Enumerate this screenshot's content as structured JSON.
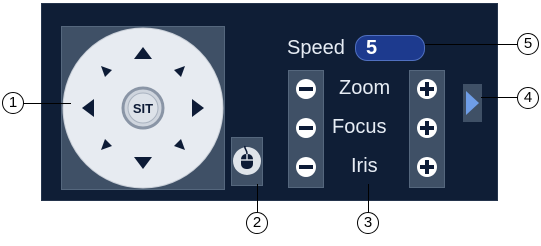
{
  "ptz": {
    "center_label": "SIT",
    "directions": [
      "up",
      "up-right",
      "right",
      "down-right",
      "down",
      "down-left",
      "left",
      "up-left"
    ]
  },
  "speed": {
    "label": "Speed",
    "value": "5"
  },
  "controls": [
    {
      "name": "zoom",
      "label": "Zoom",
      "minus": "−",
      "plus": "+"
    },
    {
      "name": "focus",
      "label": "Focus",
      "minus": "−",
      "plus": "+"
    },
    {
      "name": "iris",
      "label": "Iris",
      "minus": "−",
      "plus": "+"
    }
  ],
  "callouts": [
    "1",
    "2",
    "3",
    "4",
    "5"
  ],
  "icons": {
    "mouse": "mouse-icon",
    "side_panel": "arrow-right-icon"
  },
  "colors": {
    "panel_bg": "#0f1e36",
    "control_bg": "#3f5066",
    "speed_field": "#1d3a8e",
    "text": "#e6ecf4"
  }
}
